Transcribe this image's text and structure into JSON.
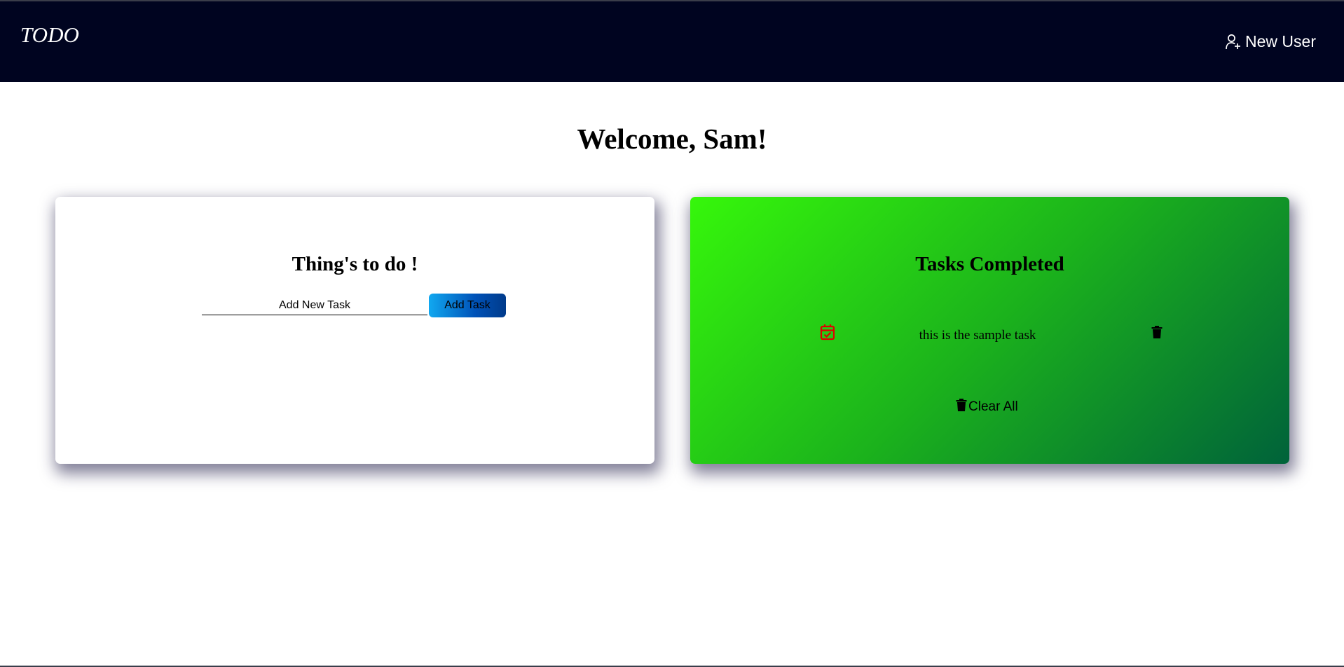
{
  "navbar": {
    "brand": "TODO",
    "new_user_label": "New User",
    "new_user_icon": "person-plus-icon",
    "background": "#000420"
  },
  "welcome": "Welcome, Sam!",
  "todo_card": {
    "title": "Thing's to do !",
    "input_placeholder": "Add New Task",
    "add_button_label": "Add Task"
  },
  "completed_card": {
    "title": "Tasks Completed",
    "tasks": [
      {
        "text": "this is the sample task",
        "status_icon": "calendar-check-icon",
        "delete_icon": "trash-icon"
      }
    ],
    "clear_all_label": "Clear All",
    "gradient": [
      "#36f70b",
      "#00623a"
    ]
  },
  "colors": {
    "accent_button": "#0a7ad8",
    "calendar_icon": "#e00000"
  }
}
